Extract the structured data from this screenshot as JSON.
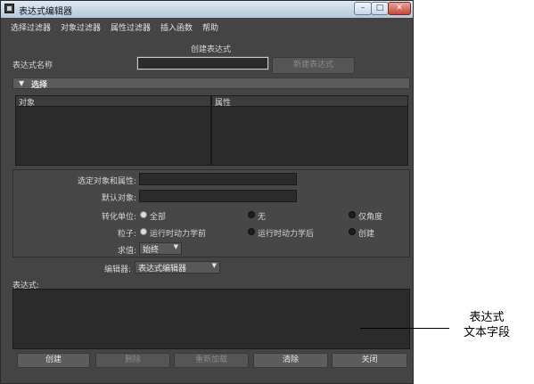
{
  "window": {
    "title": "表达式编辑器",
    "controls": {
      "minimize": "–",
      "maximize": "□",
      "close": "✕"
    }
  },
  "menubar": [
    "选择过滤器",
    "对象过滤器",
    "属性过滤器",
    "插入函数",
    "帮助"
  ],
  "mode_label": "创建表达式",
  "name_label": "表达式名称",
  "name_value": "",
  "new_expression_button": "新建表达式",
  "select_section": {
    "title": "选择",
    "objects_header": "对象",
    "attributes_header": "属性"
  },
  "selected_obj_attr_label": "选定对象和属性:",
  "selected_obj_attr_value": "",
  "default_object_label": "默认对象:",
  "default_object_value": "",
  "convert_units": {
    "label": "转化单位:",
    "options": [
      "全部",
      "无",
      "仅角度"
    ],
    "selected": 0
  },
  "particle": {
    "label": "粒子:",
    "options": [
      "运行时动力学前",
      "运行时动力学后",
      "创建"
    ],
    "selected": 0
  },
  "evaluate": {
    "label": "求值:",
    "value": "始终"
  },
  "editor": {
    "label": "编辑器:",
    "value": "表达式编辑器"
  },
  "expression_label": "表达式:",
  "expression_text": "",
  "buttons": {
    "create": "创建",
    "delete": "删除",
    "reload": "重新加载",
    "clear": "清除",
    "close": "关闭"
  },
  "annotation": {
    "line1": "表达式",
    "line2": "文本字段"
  },
  "colors": {
    "window_bg": "#444444",
    "field_bg": "#2b2b2b",
    "titlebar": "#c8d6e8"
  }
}
